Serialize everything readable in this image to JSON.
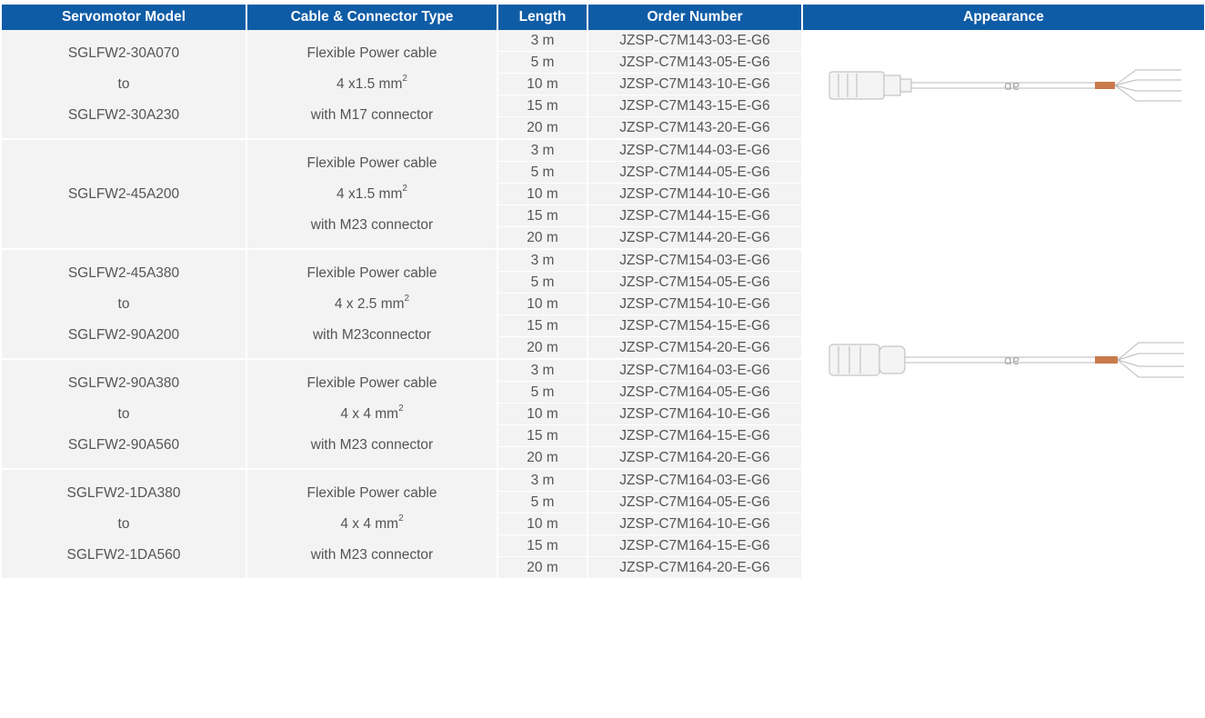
{
  "headers": {
    "model": "Servomotor Model",
    "cable": "Cable & Connector Type",
    "length": "Length",
    "order": "Order Number",
    "appearance": "Appearance"
  },
  "groups": [
    {
      "model": [
        "SGLFW2-30A070",
        "to",
        "SGLFW2-30A230"
      ],
      "cable": {
        "line1": "Flexible Power cable",
        "size": "4 x1.5 mm",
        "sup": "2",
        "line3": "with M17 connector"
      },
      "rows": [
        {
          "length": "3 m",
          "order": "JZSP-C7M143-03-E-G6"
        },
        {
          "length": "5 m",
          "order": "JZSP-C7M143-05-E-G6"
        },
        {
          "length": "10 m",
          "order": "JZSP-C7M143-10-E-G6"
        },
        {
          "length": "15 m",
          "order": "JZSP-C7M143-15-E-G6"
        },
        {
          "length": "20 m",
          "order": "JZSP-C7M143-20-E-G6"
        }
      ]
    },
    {
      "model": [
        "SGLFW2-45A200"
      ],
      "cable": {
        "line1": "Flexible Power cable",
        "size": "4 x1.5 mm",
        "sup": "2",
        "line3": "with M23 connector"
      },
      "rows": [
        {
          "length": "3 m",
          "order": "JZSP-C7M144-03-E-G6"
        },
        {
          "length": "5 m",
          "order": "JZSP-C7M144-05-E-G6"
        },
        {
          "length": "10 m",
          "order": "JZSP-C7M144-10-E-G6"
        },
        {
          "length": "15 m",
          "order": "JZSP-C7M144-15-E-G6"
        },
        {
          "length": "20 m",
          "order": "JZSP-C7M144-20-E-G6"
        }
      ]
    },
    {
      "model": [
        "SGLFW2-45A380",
        "to",
        "SGLFW2-90A200"
      ],
      "cable": {
        "line1": "Flexible Power cable",
        "size": "4 x 2.5 mm",
        "sup": "2",
        "line3": "with M23connector"
      },
      "rows": [
        {
          "length": "3 m",
          "order": "JZSP-C7M154-03-E-G6"
        },
        {
          "length": "5 m",
          "order": "JZSP-C7M154-05-E-G6"
        },
        {
          "length": "10 m",
          "order": "JZSP-C7M154-10-E-G6"
        },
        {
          "length": "15 m",
          "order": "JZSP-C7M154-15-E-G6"
        },
        {
          "length": "20 m",
          "order": "JZSP-C7M154-20-E-G6"
        }
      ]
    },
    {
      "model": [
        "SGLFW2-90A380",
        "to",
        "SGLFW2-90A560"
      ],
      "cable": {
        "line1": "Flexible Power cable",
        "size": "4 x 4 mm",
        "sup": "2",
        "line3": "with M23 connector"
      },
      "rows": [
        {
          "length": "3 m",
          "order": "JZSP-C7M164-03-E-G6"
        },
        {
          "length": "5 m",
          "order": "JZSP-C7M164-05-E-G6"
        },
        {
          "length": "10 m",
          "order": "JZSP-C7M164-10-E-G6"
        },
        {
          "length": "15 m",
          "order": "JZSP-C7M164-15-E-G6"
        },
        {
          "length": "20 m",
          "order": "JZSP-C7M164-20-E-G6"
        }
      ]
    },
    {
      "model": [
        "SGLFW2-1DA380",
        "to",
        "SGLFW2-1DA560"
      ],
      "cable": {
        "line1": "Flexible Power cable",
        "size": "4 x 4 mm",
        "sup": "2",
        "line3": "with M23 connector"
      },
      "rows": [
        {
          "length": "3 m",
          "order": "JZSP-C7M164-03-E-G6"
        },
        {
          "length": "5 m",
          "order": "JZSP-C7M164-05-E-G6"
        },
        {
          "length": "10 m",
          "order": "JZSP-C7M164-10-E-G6"
        },
        {
          "length": "15 m",
          "order": "JZSP-C7M164-15-E-G6"
        },
        {
          "length": "20 m",
          "order": "JZSP-C7M164-20-E-G6"
        }
      ]
    }
  ],
  "appearance_images": [
    {
      "icon": "m17-power-cable-icon"
    },
    {
      "icon": "m23-power-cable-icon"
    }
  ],
  "colors": {
    "header_bg": "#0f5ca6",
    "header_text": "#ffffff",
    "cell_bg": "#f3f3f3",
    "text": "#555555",
    "cable_shield": "#c97a4a"
  }
}
